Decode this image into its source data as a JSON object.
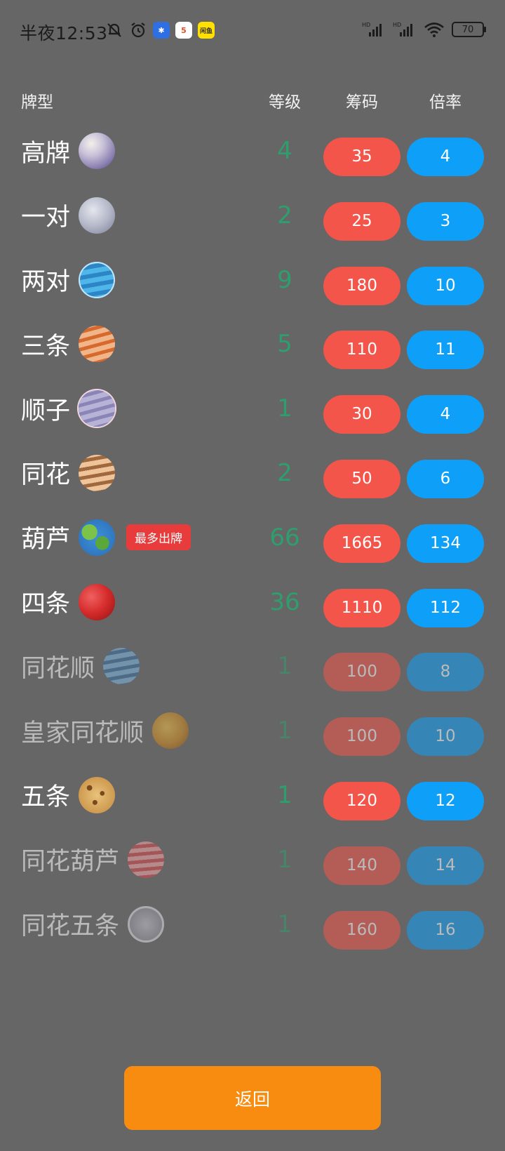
{
  "status_bar": {
    "time": "半夜12:53",
    "battery": "70",
    "app_icons": [
      "alarm-icon",
      "tool-app-icon",
      "html5-app-icon",
      "xianyu-app-icon"
    ],
    "xianyu_label": "闲鱼"
  },
  "header": {
    "type": "牌型",
    "level": "等级",
    "chips": "筹码",
    "mult": "倍率"
  },
  "rows": [
    {
      "name": "高牌",
      "level": "4",
      "chips": "35",
      "mult": "4",
      "dim": false,
      "badge": "",
      "planet": "pale-purple"
    },
    {
      "name": "一对",
      "level": "2",
      "chips": "25",
      "mult": "3",
      "dim": false,
      "badge": "",
      "planet": "grey-moon"
    },
    {
      "name": "两对",
      "level": "9",
      "chips": "180",
      "mult": "10",
      "dim": false,
      "badge": "",
      "planet": "blue-ringed"
    },
    {
      "name": "三条",
      "level": "5",
      "chips": "110",
      "mult": "11",
      "dim": false,
      "badge": "",
      "planet": "orange-striped"
    },
    {
      "name": "顺子",
      "level": "1",
      "chips": "30",
      "mult": "4",
      "dim": false,
      "badge": "",
      "planet": "lavender-ringed"
    },
    {
      "name": "同花",
      "level": "2",
      "chips": "50",
      "mult": "6",
      "dim": false,
      "badge": "",
      "planet": "tan-striped"
    },
    {
      "name": "葫芦",
      "level": "66",
      "chips": "1665",
      "mult": "134",
      "dim": false,
      "badge": "最多出牌",
      "planet": "earth"
    },
    {
      "name": "四条",
      "level": "36",
      "chips": "1110",
      "mult": "112",
      "dim": false,
      "badge": "",
      "planet": "red"
    },
    {
      "name": "同花顺",
      "level": "1",
      "chips": "100",
      "mult": "8",
      "dim": true,
      "badge": "",
      "planet": "blue-striped"
    },
    {
      "name": "皇家同花顺",
      "level": "1",
      "chips": "100",
      "mult": "10",
      "dim": true,
      "badge": "",
      "planet": "gold-dusty"
    },
    {
      "name": "五条",
      "level": "1",
      "chips": "120",
      "mult": "12",
      "dim": false,
      "badge": "",
      "planet": "cookie"
    },
    {
      "name": "同花葫芦",
      "level": "1",
      "chips": "140",
      "mult": "14",
      "dim": true,
      "badge": "",
      "planet": "pink-striped"
    },
    {
      "name": "同花五条",
      "level": "1",
      "chips": "160",
      "mult": "16",
      "dim": true,
      "badge": "",
      "planet": "white-ring"
    }
  ],
  "colors": {
    "background": "#666666",
    "level_text": "#2e9e6e",
    "chips_pill": "#f4554a",
    "mult_pill": "#0ea0f8",
    "return_button": "#f78c10",
    "badge": "#e83c3c"
  },
  "return_button": "返回"
}
